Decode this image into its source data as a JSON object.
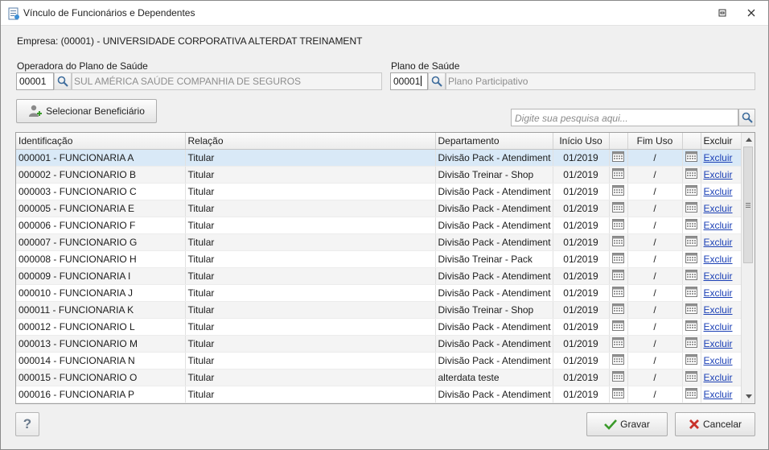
{
  "window": {
    "title": "Vínculo de Funcionários e Dependentes"
  },
  "empresa": "Empresa: (00001) - UNIVERSIDADE CORPORATIVA ALTERDAT TREINAMENT",
  "operadora": {
    "label": "Operadora do Plano de Saúde",
    "code": "00001",
    "description": "SUL AMÉRICA SAÚDE COMPANHIA DE SEGUROS"
  },
  "plano": {
    "label": "Plano de Saúde",
    "code": "00001",
    "description": "Plano Participativo"
  },
  "select_button": "Selecionar Beneficiário",
  "search": {
    "placeholder": "Digite sua pesquisa aqui..."
  },
  "grid": {
    "headers": [
      "Identificação",
      "Relação",
      "Departamento",
      "Início Uso",
      "",
      "Fim Uso",
      "",
      "Excluir"
    ],
    "rows": [
      {
        "id": "000001 - FUNCIONARIA A",
        "rel": "Titular",
        "dept": "Divisão Pack - Atendiment",
        "inicio": "01/2019",
        "fim": "/",
        "excluir": "Excluir"
      },
      {
        "id": "000002 - FUNCIONARIO B",
        "rel": "Titular",
        "dept": "Divisão Treinar - Shop",
        "inicio": "01/2019",
        "fim": "/",
        "excluir": "Excluir"
      },
      {
        "id": "000003 - FUNCIONARIO C",
        "rel": "Titular",
        "dept": "Divisão Pack - Atendiment",
        "inicio": "01/2019",
        "fim": "/",
        "excluir": "Excluir"
      },
      {
        "id": "000005 - FUNCIONARIA E",
        "rel": "Titular",
        "dept": "Divisão Pack - Atendiment",
        "inicio": "01/2019",
        "fim": "/",
        "excluir": "Excluir"
      },
      {
        "id": "000006 - FUNCIONARIO F",
        "rel": "Titular",
        "dept": "Divisão Pack - Atendiment",
        "inicio": "01/2019",
        "fim": "/",
        "excluir": "Excluir"
      },
      {
        "id": "000007 - FUNCIONARIO G",
        "rel": "Titular",
        "dept": "Divisão Pack - Atendiment",
        "inicio": "01/2019",
        "fim": "/",
        "excluir": "Excluir"
      },
      {
        "id": "000008 - FUNCIONARIO H",
        "rel": "Titular",
        "dept": "Divisão Treinar - Pack",
        "inicio": "01/2019",
        "fim": "/",
        "excluir": "Excluir"
      },
      {
        "id": "000009 - FUNCIONARIA I",
        "rel": "Titular",
        "dept": "Divisão Pack - Atendiment",
        "inicio": "01/2019",
        "fim": "/",
        "excluir": "Excluir"
      },
      {
        "id": "000010 - FUNCIONARIA J",
        "rel": "Titular",
        "dept": "Divisão Pack - Atendiment",
        "inicio": "01/2019",
        "fim": "/",
        "excluir": "Excluir"
      },
      {
        "id": "000011 - FUNCIONARIA K",
        "rel": "Titular",
        "dept": "Divisão Treinar - Shop",
        "inicio": "01/2019",
        "fim": "/",
        "excluir": "Excluir"
      },
      {
        "id": "000012 - FUNCIONARIO L",
        "rel": "Titular",
        "dept": "Divisão Pack - Atendiment",
        "inicio": "01/2019",
        "fim": "/",
        "excluir": "Excluir"
      },
      {
        "id": "000013 - FUNCIONARIO M",
        "rel": "Titular",
        "dept": "Divisão Pack - Atendiment",
        "inicio": "01/2019",
        "fim": "/",
        "excluir": "Excluir"
      },
      {
        "id": "000014 - FUNCIONARIA N",
        "rel": "Titular",
        "dept": "Divisão Pack - Atendiment",
        "inicio": "01/2019",
        "fim": "/",
        "excluir": "Excluir"
      },
      {
        "id": "000015 - FUNCIONARIO O",
        "rel": "Titular",
        "dept": "alterdata teste",
        "inicio": "01/2019",
        "fim": "/",
        "excluir": "Excluir"
      },
      {
        "id": "000016 - FUNCIONARIA P",
        "rel": "Titular",
        "dept": "Divisão Pack - Atendiment",
        "inicio": "01/2019",
        "fim": "/",
        "excluir": "Excluir"
      }
    ]
  },
  "help_button": "?",
  "gravar_button": "Gravar",
  "cancelar_button": "Cancelar",
  "colors": {
    "selected_row": "#d9e9f7",
    "link": "#1a3fb5",
    "confirm": "#3a9a2a",
    "cancel": "#c8312a"
  }
}
